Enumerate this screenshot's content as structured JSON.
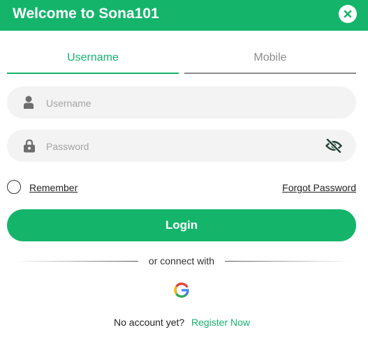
{
  "header": {
    "title": "Welcome to Sona101",
    "close_icon": "close-icon"
  },
  "tabs": [
    {
      "label": "Username",
      "active": true
    },
    {
      "label": "Mobile",
      "active": false
    }
  ],
  "form": {
    "username_placeholder": "Username",
    "username_value": "",
    "username_icon": "user-icon",
    "password_placeholder": "Password",
    "password_value": "",
    "password_icon": "lock-icon",
    "password_visibility_icon": "eye-off-icon",
    "remember_label": "Remember",
    "remember_checked": false,
    "forgot_label": "Forgot Password",
    "login_label": "Login"
  },
  "social": {
    "divider_text": "or connect with",
    "google_icon": "google-icon"
  },
  "footer": {
    "no_account_text": "No account yet?",
    "register_label": "Register Now"
  },
  "colors": {
    "brand": "#14b56b",
    "field_bg": "#f2f3f2",
    "inactive_tab": "#8c8c8c"
  }
}
